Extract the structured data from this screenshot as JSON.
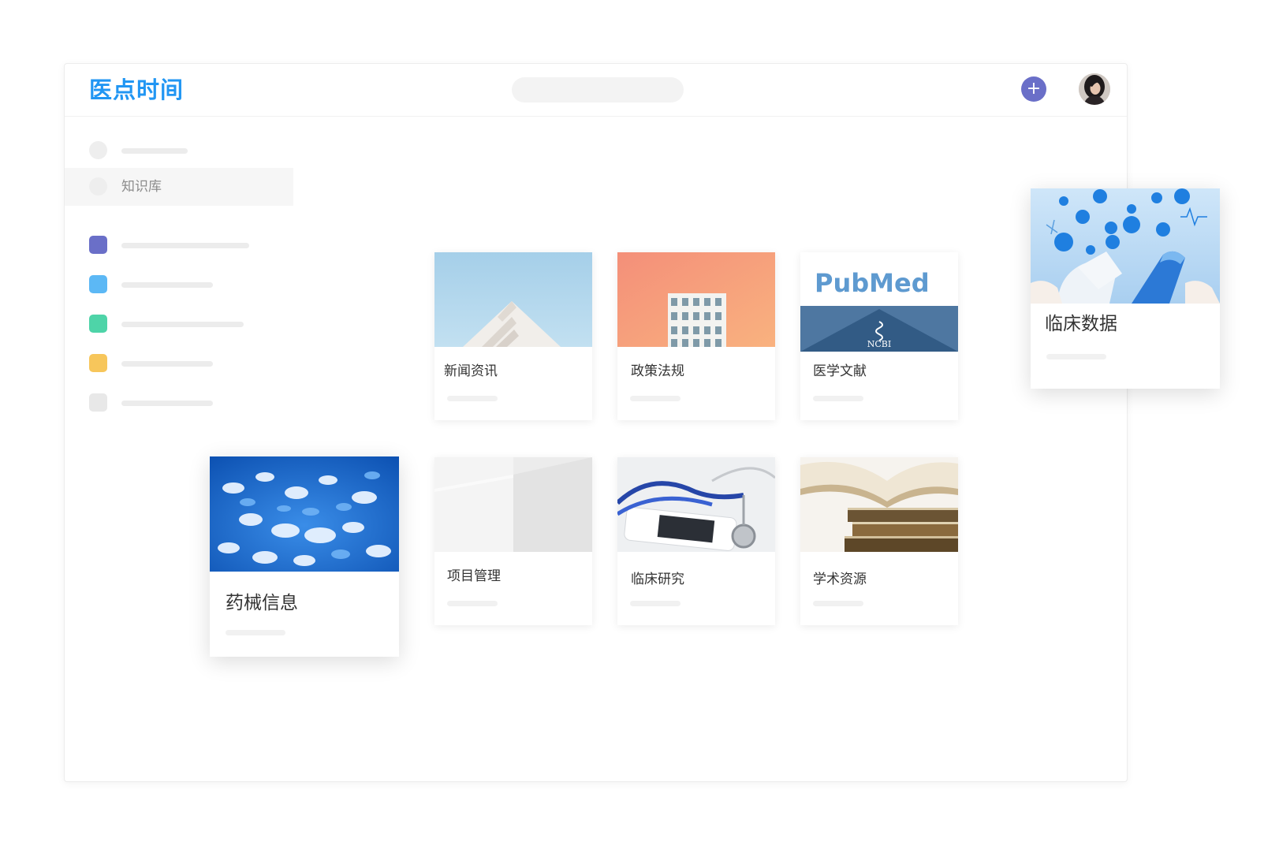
{
  "app": {
    "logo": "医点时间"
  },
  "header": {
    "add_symbol": "+"
  },
  "sidebar": {
    "active_label": "知识库",
    "category_colors": [
      "#6a6fc8",
      "#5cb8f5",
      "#4ed4a8",
      "#f7c65b",
      "#e8e8e8"
    ]
  },
  "cards": [
    {
      "title": "新闻资讯",
      "image": "building-against-sky"
    },
    {
      "title": "政策法规",
      "image": "building-against-orange-sky"
    },
    {
      "title": "医学文献",
      "image": "pubmed-ncbi-logo",
      "logo_text": "PubMed",
      "logo_sub": "NCBI"
    },
    {
      "title": "临床数据",
      "image": "medical-icons-capsule"
    },
    {
      "title": "药械信息",
      "image": "blue-pills"
    },
    {
      "title": "项目管理",
      "image": "white-wall"
    },
    {
      "title": "临床研究",
      "image": "stethoscope-and-phone"
    },
    {
      "title": "学术资源",
      "image": "open-books"
    }
  ],
  "colors": {
    "brand": "#2196f3",
    "accent": "#6a6fc8"
  }
}
